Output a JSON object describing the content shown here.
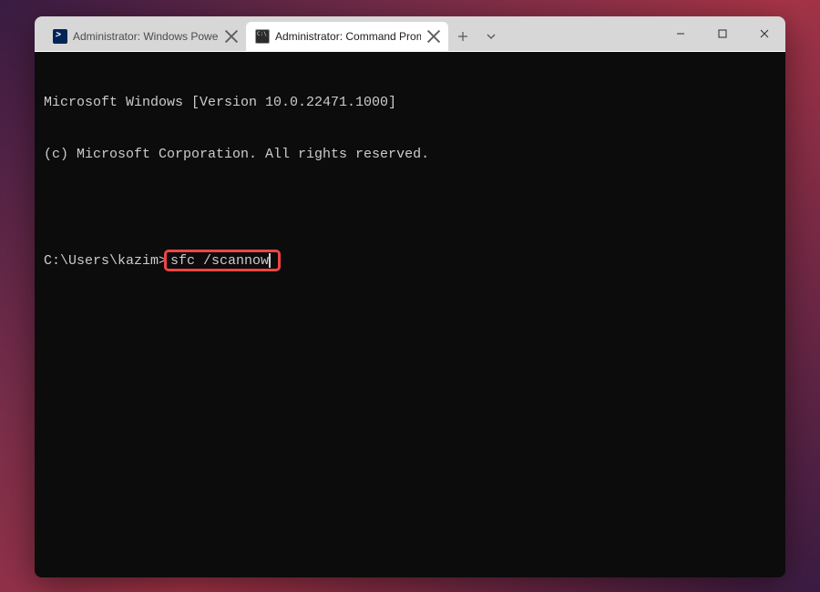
{
  "tabs": [
    {
      "label": "Administrator: Windows PowerS",
      "icon": "powershell",
      "active": false
    },
    {
      "label": "Administrator: Command Prom",
      "icon": "cmd",
      "active": true
    }
  ],
  "window_controls": {
    "minimize": "minimize",
    "maximize": "maximize",
    "close": "close"
  },
  "terminal": {
    "line1": "Microsoft Windows [Version 10.0.22471.1000]",
    "line2": "(c) Microsoft Corporation. All rights reserved.",
    "prompt": "C:\\Users\\kazim>",
    "command": "sfc /scannow"
  },
  "colors": {
    "terminal_bg": "#0c0c0c",
    "terminal_fg": "#cccccc",
    "titlebar_bg": "#d7d7d7",
    "active_tab_bg": "#ffffff",
    "highlight_border": "#ef4444"
  }
}
